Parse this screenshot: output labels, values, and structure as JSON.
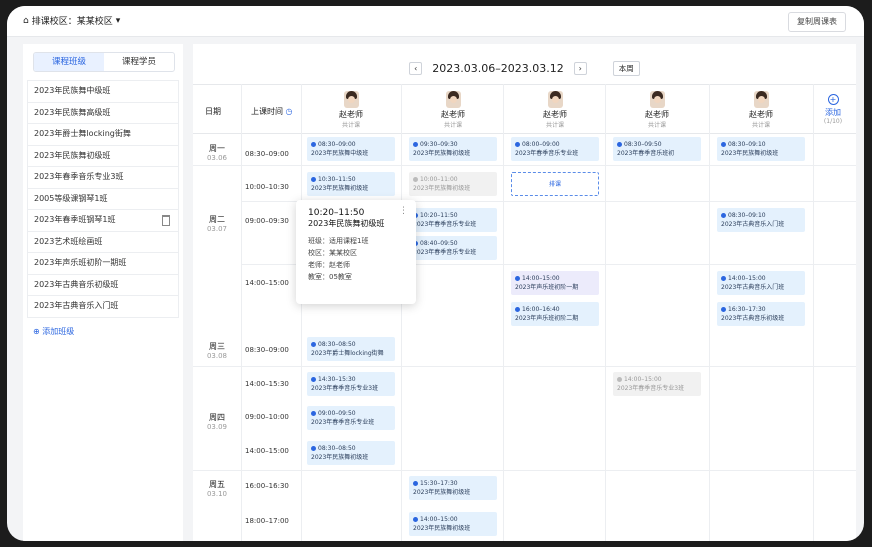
{
  "topbar": {
    "school_label": "排课校区：某某校区",
    "copy_button": "复制周课表"
  },
  "left": {
    "tabs": [
      "课程班级",
      "课程学员"
    ],
    "active_tab": 0,
    "classes": [
      "2023年民族舞中级班",
      "2023年民族舞高级班",
      "2023年爵士舞locking街舞",
      "2023年民族舞初级班",
      "2023年春季音乐专业3班",
      "2005等级课钢琴1班",
      "2023年春季班钢琴1班",
      "2023艺术班绘画班",
      "2023年声乐班初阶一期班",
      "2023年古典音乐初级班",
      "2023年古典音乐入门班"
    ],
    "add_class": "添加班级"
  },
  "week": {
    "range": "2023.03.06–2023.03.12",
    "prev": "‹",
    "next": "›",
    "today": "本周"
  },
  "grid": {
    "day_header": "日期",
    "time_header": "上课时间",
    "teachers": [
      {
        "name": "赵老师",
        "sub": "共计课"
      },
      {
        "name": "赵老师",
        "sub": "共计课"
      },
      {
        "name": "赵老师",
        "sub": "共计课"
      },
      {
        "name": "赵老师",
        "sub": "共计课"
      },
      {
        "name": "赵老师",
        "sub": "共计课"
      }
    ],
    "add_col": "添加",
    "add_col_sub": "(1/10)",
    "days": [
      {
        "label": "周一",
        "date": "03.06"
      },
      {
        "label": "周二",
        "date": "03.07"
      },
      {
        "label": "周三",
        "date": "03.08"
      },
      {
        "label": "周四",
        "date": "03.09"
      },
      {
        "label": "周五",
        "date": "03.10"
      }
    ],
    "times": [
      "08:30–09:00",
      "10:00–10:30",
      "09:00–09:30",
      "14:00–15:00",
      "08:30–09:00",
      "14:00–15:30",
      "09:00–10:00",
      "14:00–15:00",
      "16:00–16:30",
      "18:00–17:00"
    ],
    "events": [
      {
        "time": "08:30–09:00",
        "name": "2023年民族舞中级班"
      },
      {
        "time": "09:30–09:30",
        "name": "2023年民族舞初级班"
      },
      {
        "time": "08:00–09:00",
        "name": "2023年春季音乐专业班"
      },
      {
        "time": "08:30–09:50",
        "name": "2023年春季音乐班初"
      },
      {
        "time": "08:30–09:10",
        "name": "2023年民族舞初级班"
      },
      {
        "time": "10:30–11:50",
        "name": "2023年民族舞初级班"
      },
      {
        "time": "10:00–11:00",
        "name": "2023年民族舞初级班"
      },
      {
        "time": "排课",
        "name": ""
      },
      {
        "time": "10:20–11:50",
        "name": "2023年春季音乐专业班"
      },
      {
        "time": "08:40–09:50",
        "name": "2023年春季音乐专业班"
      },
      {
        "time": "08:30–09:10",
        "name": "2023年古典音乐入门班"
      },
      {
        "time": "14:00–15:00",
        "name": "2023年声乐班初阶一期"
      },
      {
        "time": "14:00–15:00",
        "name": "2023年古典音乐入门班"
      },
      {
        "time": "16:00–16:40",
        "name": "2023年声乐班初阶二期"
      },
      {
        "time": "16:30–17:30",
        "name": "2023年古典音乐初级班"
      },
      {
        "time": "08:30–08:50",
        "name": "2023年爵士舞locking街舞"
      },
      {
        "time": "14:30–15:30",
        "name": "2023年春季音乐专业3班"
      },
      {
        "time": "14:00–15:00",
        "name": "2023年春季音乐专业3班"
      },
      {
        "time": "09:00–09:50",
        "name": "2023年春季音乐专业班"
      },
      {
        "time": "08:30–08:50",
        "name": "2023年民族舞初级班"
      },
      {
        "time": "15:30–17:30",
        "name": "2023年民族舞初级班"
      },
      {
        "time": "14:00–15:00",
        "name": "2023年民族舞初级班"
      }
    ]
  },
  "popup": {
    "time": "10:20–11:50",
    "name": "2023年民族舞初级班",
    "rows": [
      "班级：适用课程1班",
      "校区：某某校区",
      "老师：赵老师",
      "教室：05教室"
    ]
  },
  "colors": {
    "accent": "#2b66e0",
    "event_bg": "#e4f1fd",
    "event_purple": "#ecebfb",
    "event_grey": "#f1f1f1"
  }
}
